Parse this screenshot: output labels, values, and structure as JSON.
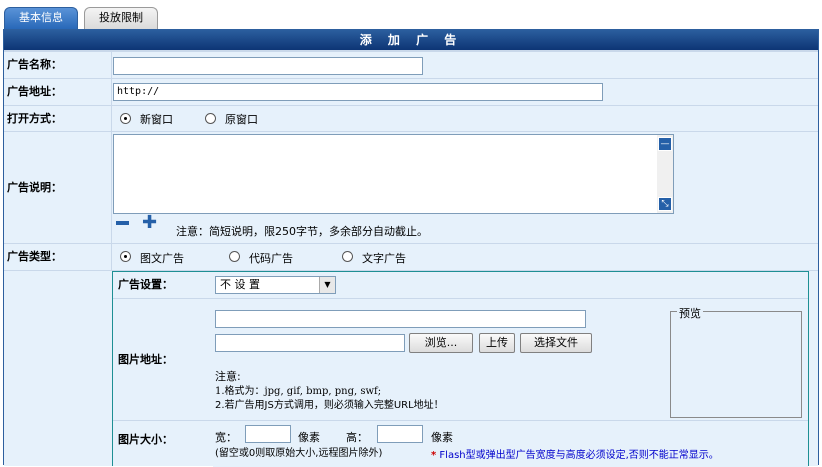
{
  "tabs": [
    {
      "label": "基本信息",
      "active": true
    },
    {
      "label": "投放限制",
      "active": false
    }
  ],
  "title": "添 加 广 告",
  "fields": {
    "name": {
      "label": "广告名称：",
      "value": ""
    },
    "url": {
      "label": "广告地址：",
      "value": "http://"
    },
    "open_mode": {
      "label": "打开方式：",
      "options": [
        "新窗口",
        "原窗口"
      ],
      "selected": "新窗口"
    },
    "desc": {
      "label": "广告说明：",
      "note": "注意：简短说明，限250字节，多余部分自动截止。"
    },
    "type": {
      "label": "广告类型：",
      "options": [
        "图文广告",
        "代码广告",
        "文字广告"
      ],
      "selected": "图文广告"
    }
  },
  "settings": {
    "label": "广告设置：",
    "select_value": "不 设 置"
  },
  "image": {
    "label": "图片地址：",
    "input1": "",
    "input2": "",
    "buttons": {
      "browse": "浏览...",
      "upload": "上传",
      "choose": "选择文件"
    },
    "preview_legend": "预览",
    "notes": {
      "title": "注意:",
      "line1": "1.格式为：jpg, gif, bmp, png, swf;",
      "line2": "2.若广告用JS方式调用，则必须输入完整URL地址！"
    }
  },
  "size": {
    "label": "图片大小：",
    "width_label": "宽：",
    "unit": "像素",
    "height_label": "高：",
    "hint": "(留空或0则取原始大小,远程图片除外)",
    "warning": "* Flash型或弹出型广告宽度与高度必须设定,否则不能正常显示。"
  },
  "colors": {
    "titlebar": "#0d3575",
    "accent": "#2560a8",
    "warning_star": "#cc0000",
    "warning_text": "#0000cc"
  }
}
